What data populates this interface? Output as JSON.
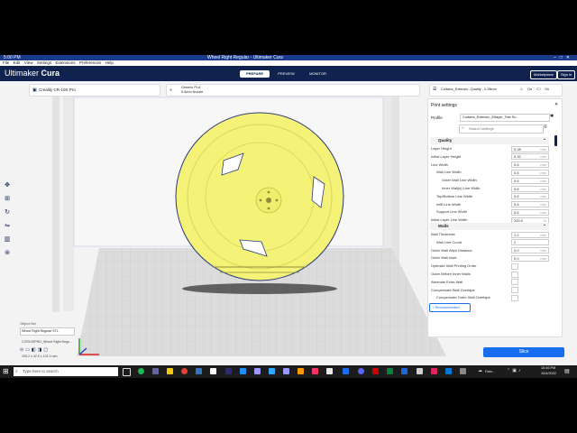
{
  "titlebar": {
    "corner": "5:00 PM",
    "title": "Wheel Right Regular - Ultimaker Cura"
  },
  "menu": {
    "items": [
      "File",
      "Edit",
      "View",
      "Settings",
      "Extensions",
      "Preferences",
      "Help"
    ]
  },
  "header": {
    "brand_light": "Ultimaker ",
    "brand_strong": "Cura",
    "stages": [
      "PREPARE",
      "PREVIEW",
      "MONITOR"
    ],
    "marketplace": "Marketplace",
    "signin": "Sign in"
  },
  "printer": {
    "name": "Creality CR-10S Pro"
  },
  "material": {
    "line1": "Generic PLA",
    "line2": "0.4mm Nozzle"
  },
  "print": {
    "summary": "Cortana_Extensiv...Quality - 0.28mm",
    "support": "On",
    "adhesion": "On"
  },
  "settings": {
    "title": "Print settings",
    "profile_label": "Profile",
    "profile_value": "Cortana_Extensiv_20layer_Test Sc...",
    "search_placeholder": "Search settings",
    "quality_header": "Quality",
    "walls_header": "Walls",
    "rows": [
      {
        "label": "Layer Height",
        "value": "0.28",
        "unit": "mm",
        "indent": 0
      },
      {
        "label": "Initial Layer Height",
        "value": "0.32",
        "unit": "mm",
        "indent": 0
      },
      {
        "label": "Line Width",
        "value": "0.6",
        "unit": "mm",
        "indent": 0
      },
      {
        "label": "Wall Line Width",
        "value": "0.6",
        "unit": "mm",
        "indent": 1
      },
      {
        "label": "Outer Wall Line Width",
        "value": "0.6",
        "unit": "mm",
        "indent": 2
      },
      {
        "label": "Inner Wall(s) Line Width",
        "value": "0.6",
        "unit": "mm",
        "indent": 2
      },
      {
        "label": "Top/Bottom Line Width",
        "value": "0.6",
        "unit": "mm",
        "indent": 1
      },
      {
        "label": "Infill Line Width",
        "value": "0.6",
        "unit": "mm",
        "indent": 1
      },
      {
        "label": "Support Line Width",
        "value": "0.6",
        "unit": "mm",
        "indent": 1
      },
      {
        "label": "Initial Layer Line Width",
        "value": "100.0",
        "unit": "%",
        "indent": 0
      }
    ],
    "wall_rows": [
      {
        "label": "Wall Thickness",
        "value": "1.2",
        "unit": "mm",
        "indent": 0
      },
      {
        "label": "Wall Line Count",
        "value": "2",
        "unit": "",
        "indent": 1
      },
      {
        "label": "Outer Wall Wipe Distance",
        "value": "0.0",
        "unit": "mm",
        "indent": 0
      },
      {
        "label": "Outer Wall Inset",
        "value": "0.0",
        "unit": "mm",
        "indent": 0
      },
      {
        "label": "Optimize Wall Printing Order",
        "value": "",
        "unit": "",
        "indent": 0,
        "checkbox": true
      },
      {
        "label": "Outer Before Inner Walls",
        "value": "",
        "unit": "",
        "indent": 0,
        "checkbox": true
      },
      {
        "label": "Alternate Extra Wall",
        "value": "",
        "unit": "",
        "indent": 0,
        "checkbox": true
      },
      {
        "label": "Compensate Wall Overlaps",
        "value": "",
        "unit": "",
        "indent": 0,
        "checkbox": true
      },
      {
        "label": "Compensate Outer Wall Overlaps",
        "value": "",
        "unit": "",
        "indent": 1,
        "checkbox": true
      }
    ],
    "recommended": "Recommended"
  },
  "object_list": {
    "header": "Object list",
    "item": "Wheel Right Regular STL",
    "file": "CCR10SPRO_Wheel Right Regu...",
    "dims": "105.2 x 42.9 x 101.0 mm"
  },
  "slice_label": "Slice",
  "taskbar": {
    "search_placeholder": "Type here to search",
    "time": "10:46 PM",
    "date": "10/4/2022",
    "weather": "Rain..."
  }
}
